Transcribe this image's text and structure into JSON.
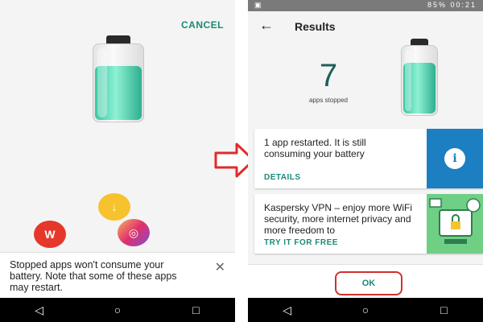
{
  "left_screen": {
    "cancel_label": "CANCEL",
    "app_icons": [
      {
        "name": "downloader-app-icon",
        "color": "#f6c22d",
        "symbol": "↓"
      },
      {
        "name": "wps-office-app-icon",
        "color": "#e5382a",
        "symbol": "W"
      },
      {
        "name": "instagram-app-icon",
        "color": "#e1306c",
        "symbol": "◎"
      }
    ],
    "banner_text": "Stopped apps won't consume your battery. Note that some of these apps may restart.",
    "banner_close_icon": "close-icon"
  },
  "right_screen": {
    "status_bar": {
      "left_icon": "image-icon",
      "right_text": "85%  00:21",
      "icons": [
        "vibrate-icon",
        "alarm-icon",
        "wifi-icon",
        "signal-icon",
        "battery-icon"
      ]
    },
    "title": "Results",
    "back_icon": "back-arrow-icon",
    "apps_stopped_count": "7",
    "apps_stopped_label": "apps stopped",
    "cards": [
      {
        "text": "1 app restarted. It is still consuming your battery",
        "link": "DETAILS",
        "side_icon": "info-icon",
        "side_color": "#1b7fc1"
      },
      {
        "text": "Kaspersky VPN – enjoy more WiFi security, more internet privacy and more freedom to",
        "link": "TRY IT FOR FREE",
        "side_icon": "vpn-illustration",
        "side_color": "#6fcf85"
      }
    ],
    "ok_label": "OK"
  },
  "nav_bar": {
    "icons": [
      "back-triangle-icon",
      "home-circle-icon",
      "recents-square-icon"
    ]
  },
  "colors": {
    "accent": "#1a8a78",
    "highlight": "#d0312d",
    "battery_fill": "#39c7a3"
  }
}
